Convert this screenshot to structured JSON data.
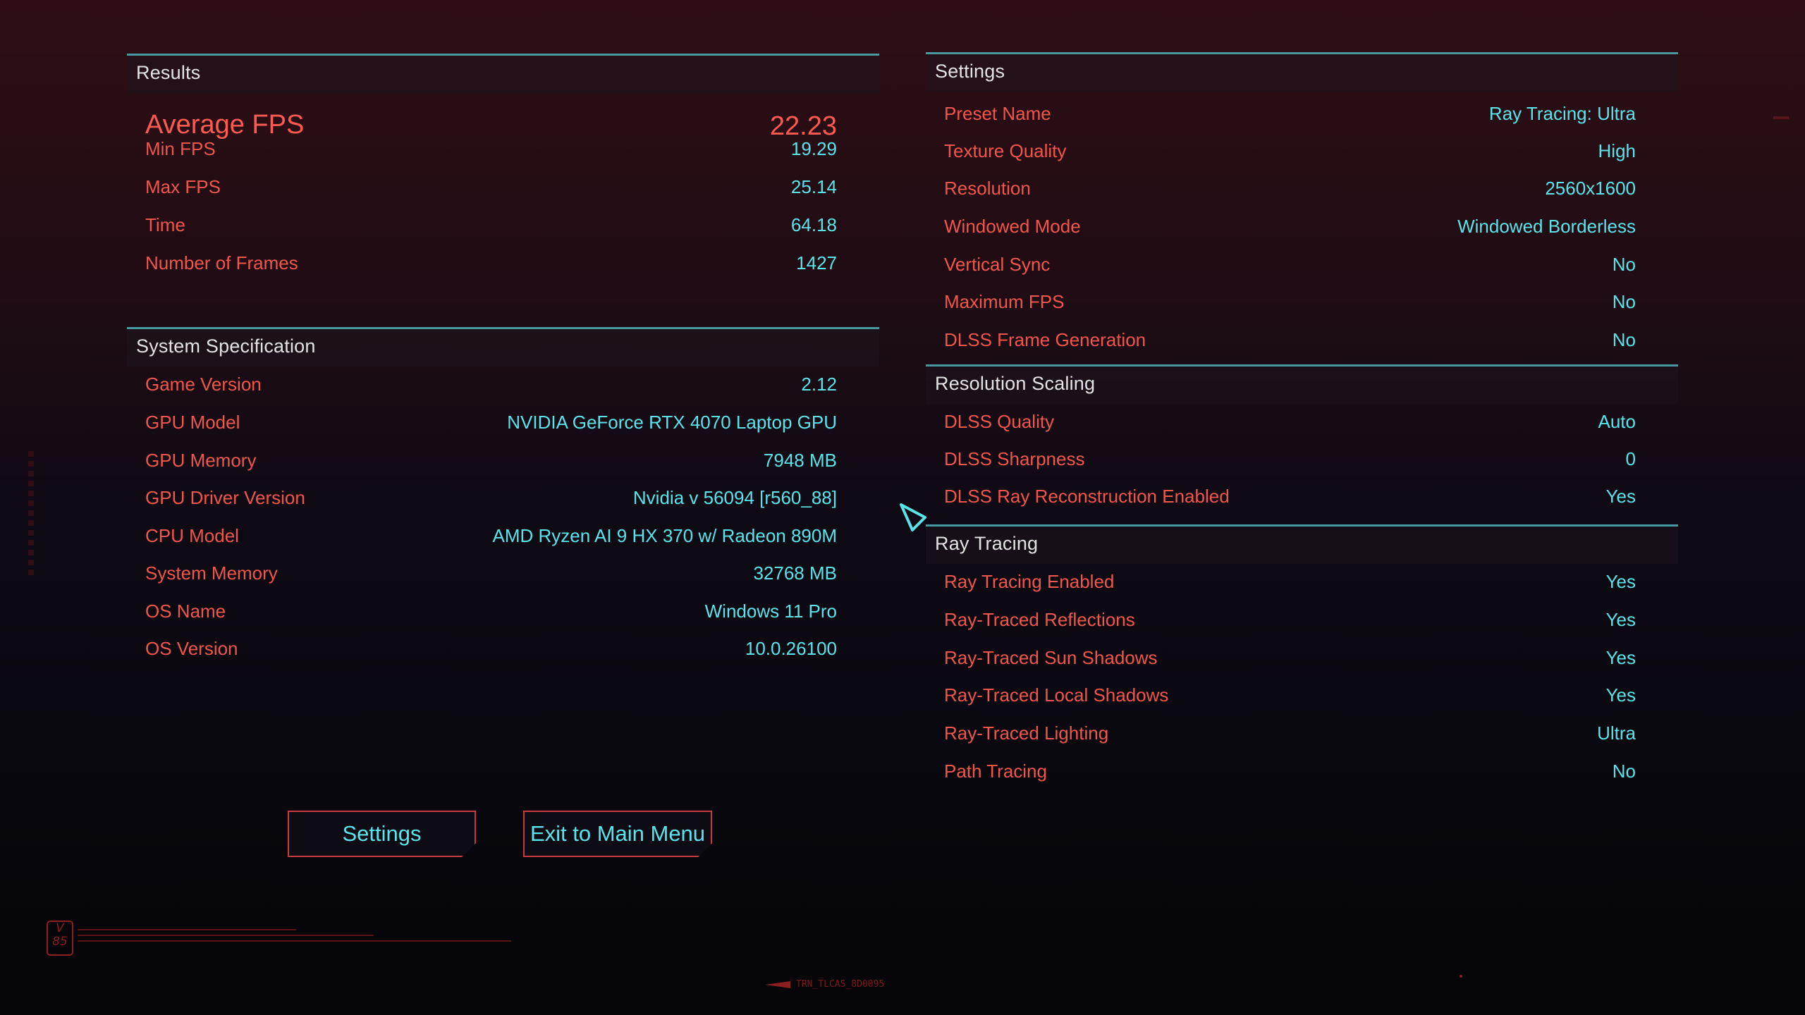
{
  "results": {
    "title": "Results",
    "average_fps": {
      "label": "Average FPS",
      "value": "22.23"
    },
    "rows": [
      {
        "label": "Min FPS",
        "value": "19.29"
      },
      {
        "label": "Max FPS",
        "value": "25.14"
      },
      {
        "label": "Time",
        "value": "64.18"
      },
      {
        "label": "Number of Frames",
        "value": "1427"
      }
    ]
  },
  "system_spec": {
    "title": "System Specification",
    "rows": [
      {
        "label": "Game Version",
        "value": "2.12"
      },
      {
        "label": "GPU Model",
        "value": "NVIDIA GeForce RTX 4070 Laptop GPU"
      },
      {
        "label": "GPU Memory",
        "value": "7948 MB"
      },
      {
        "label": "GPU Driver Version",
        "value": "Nvidia v 56094 [r560_88]"
      },
      {
        "label": "CPU Model",
        "value": "AMD Ryzen AI 9 HX 370 w/ Radeon 890M"
      },
      {
        "label": "System Memory",
        "value": "32768 MB"
      },
      {
        "label": "OS Name",
        "value": "Windows 11 Pro"
      },
      {
        "label": "OS Version",
        "value": "10.0.26100"
      }
    ]
  },
  "settings": {
    "title": "Settings",
    "rows": [
      {
        "label": "Preset Name",
        "value": "Ray Tracing: Ultra"
      },
      {
        "label": "Texture Quality",
        "value": "High"
      },
      {
        "label": "Resolution",
        "value": "2560x1600"
      },
      {
        "label": "Windowed Mode",
        "value": "Windowed Borderless"
      },
      {
        "label": "Vertical Sync",
        "value": "No"
      },
      {
        "label": "Maximum FPS",
        "value": "No"
      },
      {
        "label": "DLSS Frame Generation",
        "value": "No"
      }
    ]
  },
  "resolution_scaling": {
    "title": "Resolution Scaling",
    "rows": [
      {
        "label": "DLSS Quality",
        "value": "Auto"
      },
      {
        "label": "DLSS Sharpness",
        "value": "0"
      },
      {
        "label": "DLSS Ray Reconstruction Enabled",
        "value": "Yes"
      }
    ]
  },
  "ray_tracing": {
    "title": "Ray Tracing",
    "rows": [
      {
        "label": "Ray Tracing Enabled",
        "value": "Yes"
      },
      {
        "label": "Ray-Traced Reflections",
        "value": "Yes"
      },
      {
        "label": "Ray-Traced Sun Shadows",
        "value": "Yes"
      },
      {
        "label": "Ray-Traced Local Shadows",
        "value": "Yes"
      },
      {
        "label": "Ray-Traced Lighting",
        "value": "Ultra"
      },
      {
        "label": "Path Tracing",
        "value": "No"
      }
    ]
  },
  "buttons": {
    "settings": "Settings",
    "exit": "Exit to Main Menu"
  },
  "footer": {
    "badge_top": "V",
    "badge_bottom": "85",
    "code": "TRN_TLCAS_8D0095"
  },
  "colors": {
    "label": "#f0564c",
    "value": "#5ae4ea",
    "section_line": "#4fb3b8",
    "button_border": "#c83c40"
  }
}
